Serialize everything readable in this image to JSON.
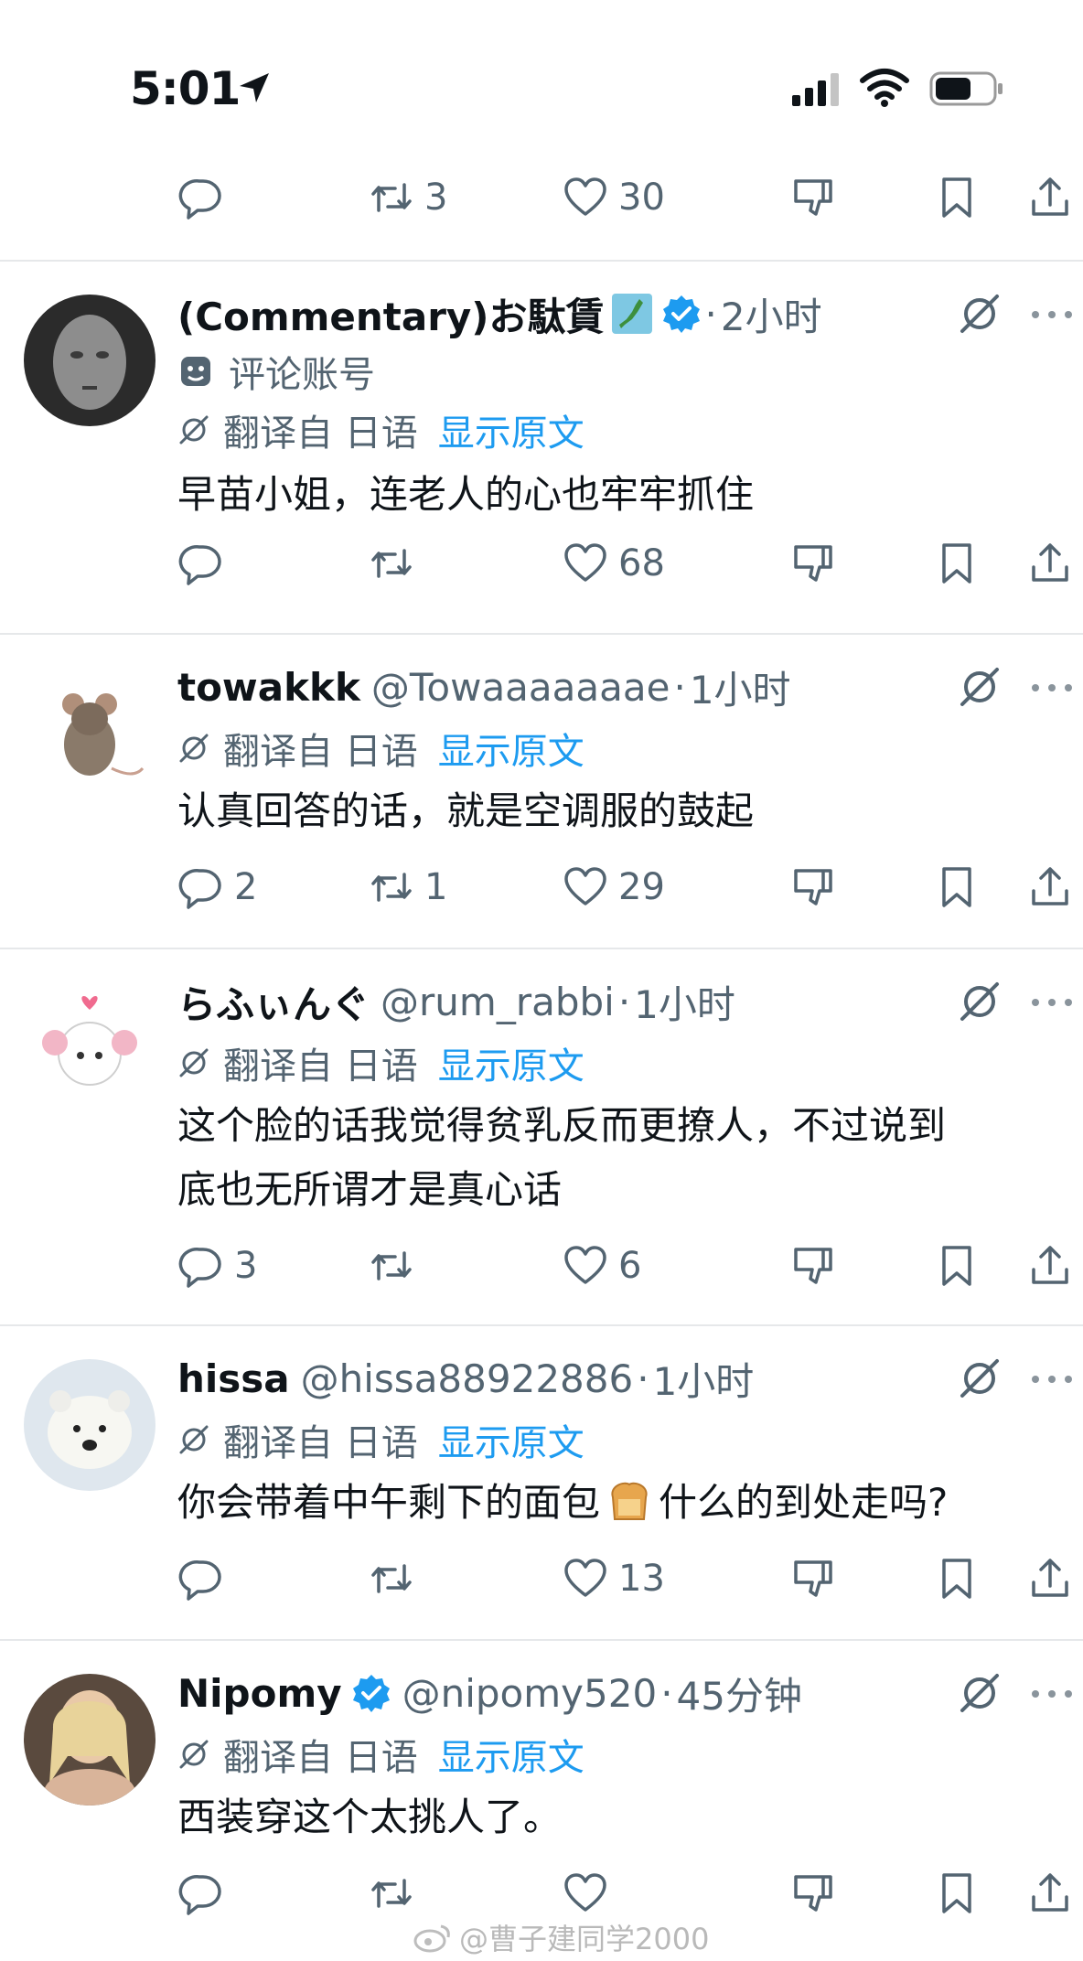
{
  "status_bar": {
    "time": "5:01",
    "icons": [
      "location-arrow-icon",
      "cellular-signal-icon",
      "wifi-icon",
      "battery-icon"
    ]
  },
  "top_actions": {
    "reply": "",
    "retweet": "3",
    "like": "30"
  },
  "translation": {
    "from": "翻译自 日语",
    "show_original": "显示原文"
  },
  "colors": {
    "accent": "#1d9bf0",
    "muted": "#536471",
    "text": "#0f1419",
    "separator": "#e6e8ea"
  },
  "tweets": [
    {
      "display_name": "(Commentary)お駄賃",
      "handle": "",
      "time": "2小时",
      "verified": true,
      "flag_emoji": "japan-map-icon",
      "label": "评论账号",
      "label_icon": "theater-masks-icon",
      "text": "早苗小姐，连老人的心也牢牢抓住",
      "reply": "",
      "retweet": "",
      "like": "68"
    },
    {
      "display_name": "towakkk",
      "handle": "@Towaaaaaaae",
      "time": "1小时",
      "verified": false,
      "text": "认真回答的话，就是空调服的鼓起",
      "reply": "2",
      "retweet": "1",
      "like": "29"
    },
    {
      "display_name": "らふぃんぐ",
      "handle": "@rum_rabbi",
      "time": "1小时",
      "verified": false,
      "text_line1": "这个脸的话我觉得贫乳反而更撩人，不过说到",
      "text_line2": "底也无所谓才是真心话",
      "reply": "3",
      "retweet": "",
      "like": "6"
    },
    {
      "display_name": "hissa",
      "handle": "@hissa88922886",
      "time": "1小时",
      "verified": false,
      "text_before": "你会带着中午剩下的面包",
      "text_emoji": "bread-emoji-icon",
      "text_after": "什么的到处走吗?",
      "reply": "",
      "retweet": "",
      "like": "13"
    },
    {
      "display_name": "Nipomy",
      "handle": "@nipomy520",
      "time": "45分钟",
      "verified": true,
      "text": "西装穿这个太挑人了。",
      "reply": "",
      "retweet": "",
      "like": ""
    }
  ],
  "watermark": "@曹子建同学2000"
}
